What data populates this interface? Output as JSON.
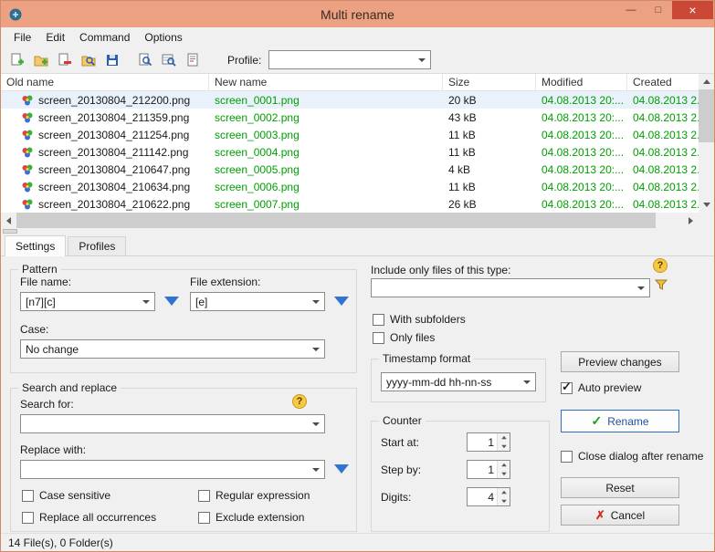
{
  "window": {
    "title": "Multi rename"
  },
  "glyphs": {
    "minimize": "—",
    "maximize": "□",
    "close": "×",
    "check": "✓",
    "cross": "✗",
    "question": "?"
  },
  "menu": {
    "file": "File",
    "edit": "Edit",
    "command": "Command",
    "options": "Options"
  },
  "toolbar": {
    "profile_label": "Profile:",
    "profile_value": ""
  },
  "list": {
    "columns": {
      "old": "Old name",
      "new": "New name",
      "size": "Size",
      "modified": "Modified",
      "created": "Created"
    },
    "rows": [
      {
        "old": "screen_20130804_212200.png",
        "new": "screen_0001.png",
        "size": "20 kB",
        "modified": "04.08.2013 20:...",
        "created": "04.08.2013 2..."
      },
      {
        "old": "screen_20130804_211359.png",
        "new": "screen_0002.png",
        "size": "43 kB",
        "modified": "04.08.2013 20:...",
        "created": "04.08.2013 2..."
      },
      {
        "old": "screen_20130804_211254.png",
        "new": "screen_0003.png",
        "size": "11 kB",
        "modified": "04.08.2013 20:...",
        "created": "04.08.2013 2..."
      },
      {
        "old": "screen_20130804_211142.png",
        "new": "screen_0004.png",
        "size": "11 kB",
        "modified": "04.08.2013 20:...",
        "created": "04.08.2013 2..."
      },
      {
        "old": "screen_20130804_210647.png",
        "new": "screen_0005.png",
        "size": "4 kB",
        "modified": "04.08.2013 20:...",
        "created": "04.08.2013 2..."
      },
      {
        "old": "screen_20130804_210634.png",
        "new": "screen_0006.png",
        "size": "11 kB",
        "modified": "04.08.2013 20:...",
        "created": "04.08.2013 2..."
      },
      {
        "old": "screen_20130804_210622.png",
        "new": "screen_0007.png",
        "size": "26 kB",
        "modified": "04.08.2013 20:...",
        "created": "04.08.2013 2..."
      }
    ]
  },
  "tabs": {
    "settings": "Settings",
    "profiles": "Profiles"
  },
  "pattern": {
    "group_label": "Pattern",
    "file_name_label": "File name:",
    "file_name_value": "[n7][c]",
    "file_extension_label": "File extension:",
    "file_extension_value": "[e]",
    "case_label": "Case:",
    "case_value": "No change"
  },
  "search": {
    "group_label": "Search and replace",
    "search_for_label": "Search for:",
    "search_for_value": "",
    "replace_with_label": "Replace with:",
    "replace_with_value": "",
    "case_sensitive": "Case sensitive",
    "regular_expression": "Regular expression",
    "replace_all": "Replace all occurrences",
    "exclude_extension": "Exclude extension"
  },
  "filter": {
    "include_label": "Include only files of this type:",
    "include_value": "",
    "with_subfolders": "With subfolders",
    "only_files": "Only files"
  },
  "timestamp": {
    "group_label": "Timestamp format",
    "value": "yyyy-mm-dd hh-nn-ss"
  },
  "counter": {
    "group_label": "Counter",
    "start_label": "Start at:",
    "start_value": "1",
    "step_label": "Step by:",
    "step_value": "1",
    "digits_label": "Digits:",
    "digits_value": "4"
  },
  "actions": {
    "preview": "Preview changes",
    "auto_preview": "Auto preview",
    "rename": "Rename",
    "close_after": "Close dialog after rename",
    "reset": "Reset",
    "cancel": "Cancel"
  },
  "status": {
    "text": "14 File(s), 0 Folder(s)"
  },
  "colors": {
    "titlebar": "#eca183",
    "close_button": "#ca4835",
    "new_name_green": "#00a000",
    "triangle_blue": "#2f74d0"
  }
}
